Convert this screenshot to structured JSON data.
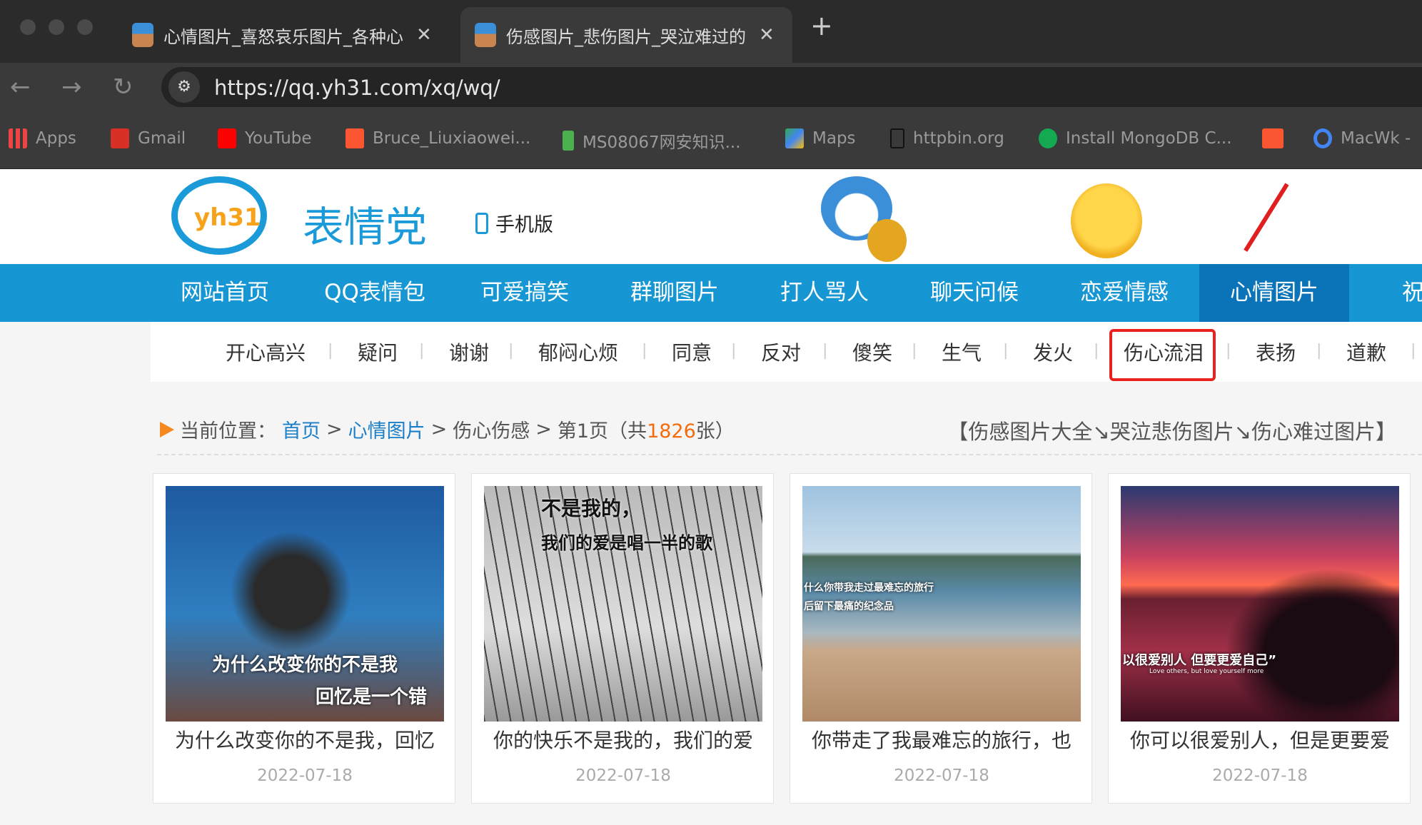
{
  "browser": {
    "tabs": [
      {
        "title": "心情图片_喜怒哀乐图片_各种心"
      },
      {
        "title": "伤感图片_悲伤图片_哭泣难过的"
      }
    ],
    "url": "https://qq.yh31.com/xq/wq/",
    "bookmarks": [
      {
        "label": "Apps",
        "color": "#e44"
      },
      {
        "label": "Gmail",
        "color": "#d93025"
      },
      {
        "label": "YouTube",
        "color": "#ff0000"
      },
      {
        "label": "Bruce_Liuxiaowei...",
        "color": "#fc5531"
      },
      {
        "label": "MS08067网安知识...",
        "color": "#4caf50"
      },
      {
        "label": "Maps",
        "color": "#34a853"
      },
      {
        "label": "httpbin.org",
        "color": "#222"
      },
      {
        "label": "Install MongoDB C...",
        "color": "#13aa52"
      },
      {
        "label": "",
        "color": "#fc5531"
      },
      {
        "label": "MacWk -",
        "color": "#4285f4"
      }
    ]
  },
  "site": {
    "logo_text": "yh31",
    "logo_name": "表情党",
    "mobile_label": "手机版",
    "nav": [
      "网站首页",
      "QQ表情包",
      "可爱搞笑",
      "群聊图片",
      "打人骂人",
      "聊天问候",
      "恋爱情感",
      "心情图片",
      "祝福"
    ],
    "nav_active": 7,
    "subnav": [
      "开心高兴",
      "疑问",
      "谢谢",
      "郁闷心烦",
      "同意",
      "反对",
      "傻笑",
      "生气",
      "发火",
      "伤心流泪",
      "表扬",
      "道歉"
    ],
    "subnav_highlight": 9,
    "breadcrumb": {
      "label": "当前位置：",
      "home": "首页",
      "cat": "心情图片",
      "sub": "伤心伤感",
      "page": "第1页（共",
      "count": "1826",
      "unit": "张）"
    },
    "section_title": "【伤感图片大全↘哭泣悲伤图片↘伤心难过图片】",
    "cards": [
      {
        "title": "为什么改变你的不是我，回忆",
        "date": "2022-07-18",
        "caption": "为什么改变你的不是我",
        "caption2": "回忆是一个错"
      },
      {
        "title": "你的快乐不是我的，我们的爱",
        "date": "2022-07-18",
        "caption": "不是我的，",
        "caption2": "我们的爱是唱一半的歌"
      },
      {
        "title": "你带走了我最难忘的旅行，也",
        "date": "2022-07-18",
        "caption": "什么你带我走过最难忘的旅行",
        "caption2": "后留下最痛的纪念品"
      },
      {
        "title": "你可以很爱别人，但是更要爱",
        "date": "2022-07-18",
        "caption": "以很爱别人 但要更爱自己”",
        "caption2": "Love others, but love yourself more"
      }
    ],
    "colors": {
      "nav": "#1696d2",
      "accent": "#f36c0c",
      "highlight": "#e8231f"
    }
  }
}
